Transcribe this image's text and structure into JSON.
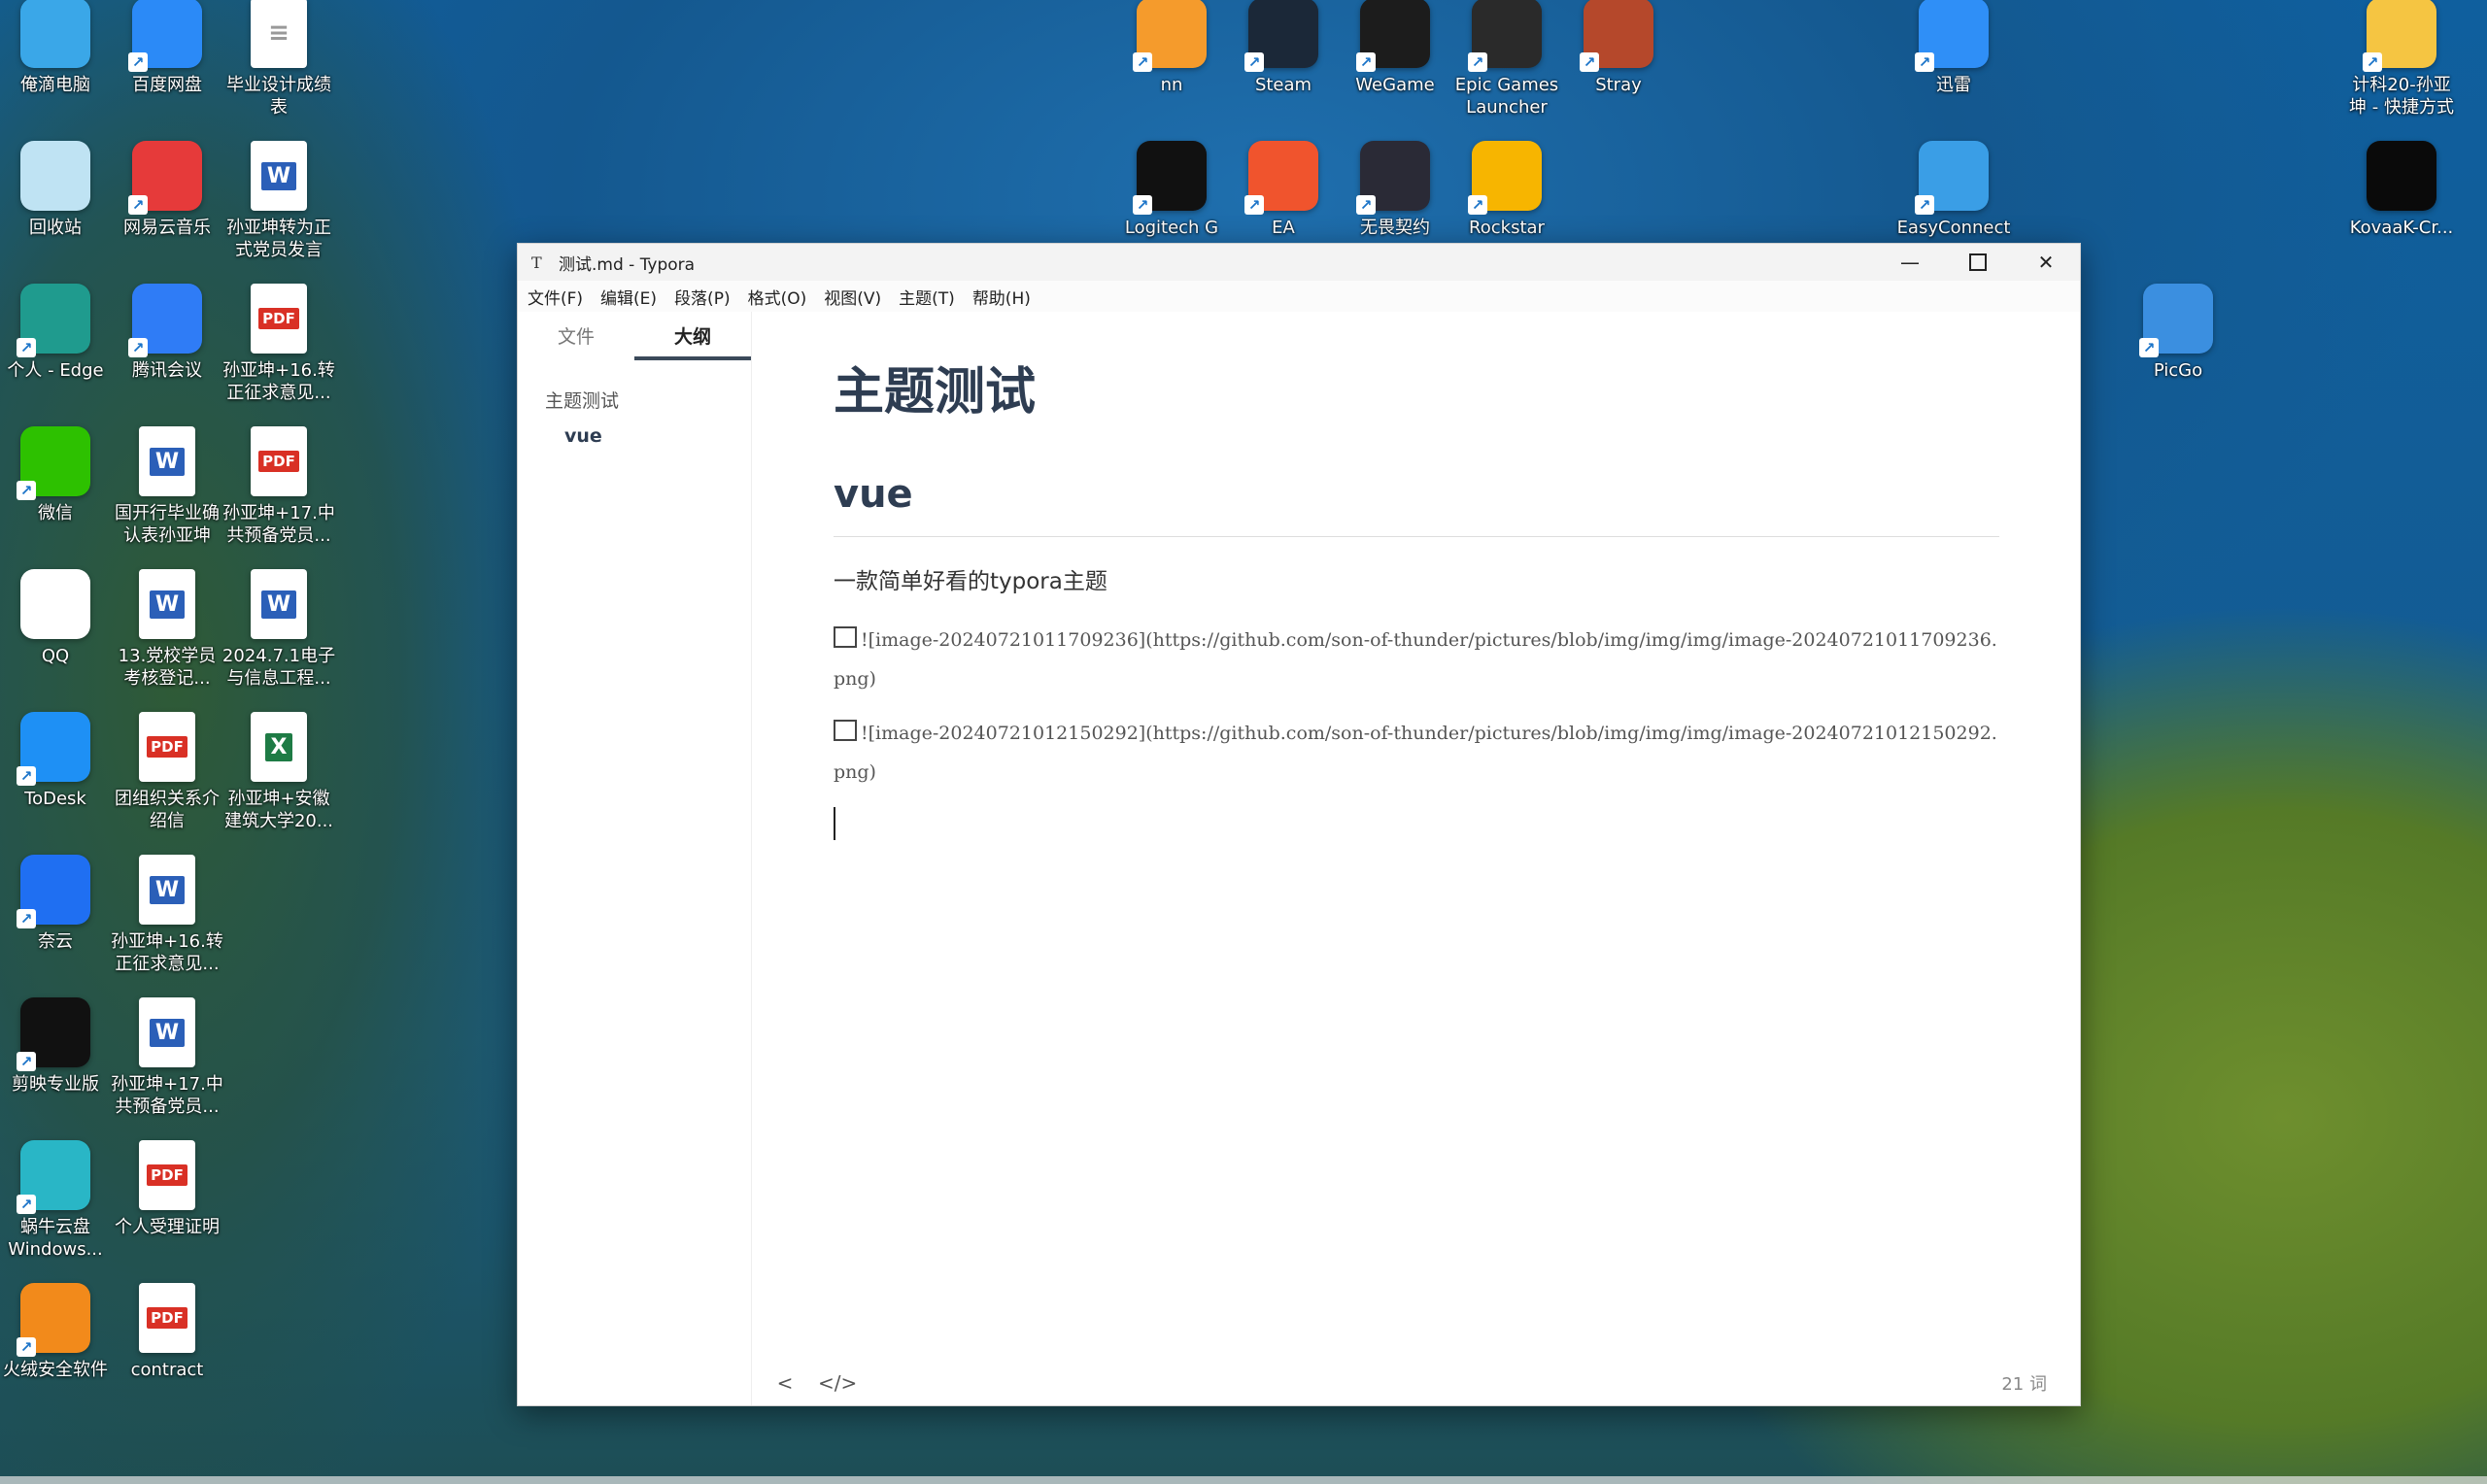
{
  "desktop": {
    "left_icons": [
      {
        "label": "俺滴电脑",
        "icon": "computer-icon",
        "color": "#3aa7e8",
        "x": 0,
        "y": 0,
        "shortcut": false
      },
      {
        "label": "百度网盘",
        "icon": "baidu-netdisk-icon",
        "color": "#2b8af7",
        "x": 1,
        "y": 0,
        "shortcut": true
      },
      {
        "label": "毕业设计成绩\n表",
        "icon": "document-icon",
        "color": "#ffffff",
        "x": 2,
        "y": 0,
        "shortcut": false
      },
      {
        "label": "回收站",
        "icon": "recycle-bin-icon",
        "color": "#bfe3f3",
        "x": 0,
        "y": 1,
        "shortcut": false
      },
      {
        "label": "网易云音乐",
        "icon": "netease-music-icon",
        "color": "#e63a3a",
        "x": 1,
        "y": 1,
        "shortcut": true
      },
      {
        "label": "孙亚坤转为正\n式党员发言",
        "icon": "word-doc-icon",
        "color": "#ffffff",
        "x": 2,
        "y": 1,
        "shortcut": false
      },
      {
        "label": "个人 - Edge",
        "icon": "edge-icon",
        "color": "#1f9b8e",
        "x": 0,
        "y": 2,
        "shortcut": true
      },
      {
        "label": "腾讯会议",
        "icon": "tencent-meeting-icon",
        "color": "#2f7cf6",
        "x": 1,
        "y": 2,
        "shortcut": true
      },
      {
        "label": "孙亚坤+16.转\n正征求意见...",
        "icon": "pdf-icon",
        "color": "#ffffff",
        "x": 2,
        "y": 2,
        "shortcut": false
      },
      {
        "label": "微信",
        "icon": "wechat-icon",
        "color": "#2dc100",
        "x": 0,
        "y": 3,
        "shortcut": true
      },
      {
        "label": "国开行毕业确\n认表孙亚坤",
        "icon": "word-doc-icon",
        "color": "#ffffff",
        "x": 1,
        "y": 3,
        "shortcut": false
      },
      {
        "label": "孙亚坤+17.中\n共预备党员...",
        "icon": "pdf-icon",
        "color": "#ffffff",
        "x": 2,
        "y": 3,
        "shortcut": false
      },
      {
        "label": "QQ",
        "icon": "qq-icon",
        "color": "#ffffff",
        "x": 0,
        "y": 4,
        "shortcut": false
      },
      {
        "label": "13.党校学员\n考核登记...",
        "icon": "word-doc-icon",
        "color": "#ffffff",
        "x": 1,
        "y": 4,
        "shortcut": false
      },
      {
        "label": "2024.7.1电子\n与信息工程...",
        "icon": "word-doc-icon",
        "color": "#ffffff",
        "x": 2,
        "y": 4,
        "shortcut": false
      },
      {
        "label": "ToDesk",
        "icon": "todesk-icon",
        "color": "#1e90f5",
        "x": 0,
        "y": 5,
        "shortcut": true
      },
      {
        "label": "团组织关系介\n绍信",
        "icon": "pdf-icon",
        "color": "#ffffff",
        "x": 1,
        "y": 5,
        "shortcut": false
      },
      {
        "label": "孙亚坤+安徽\n建筑大学20...",
        "icon": "excel-icon",
        "color": "#ffffff",
        "x": 2,
        "y": 5,
        "shortcut": false
      },
      {
        "label": "奈云",
        "icon": "naiyun-icon",
        "color": "#1f6ff2",
        "x": 0,
        "y": 6,
        "shortcut": true
      },
      {
        "label": "孙亚坤+16.转\n正征求意见...",
        "icon": "word-doc-icon",
        "color": "#ffffff",
        "x": 1,
        "y": 6,
        "shortcut": false
      },
      {
        "label": "剪映专业版",
        "icon": "capcut-icon",
        "color": "#111111",
        "x": 0,
        "y": 7,
        "shortcut": true
      },
      {
        "label": "孙亚坤+17.中\n共预备党员...",
        "icon": "word-doc-icon",
        "color": "#ffffff",
        "x": 1,
        "y": 7,
        "shortcut": false
      },
      {
        "label": "蜗牛云盘\nWindows...",
        "icon": "snail-cloud-icon",
        "color": "#29b6c6",
        "x": 0,
        "y": 8,
        "shortcut": true
      },
      {
        "label": "个人受理证明",
        "icon": "pdf-icon",
        "color": "#ffffff",
        "x": 1,
        "y": 8,
        "shortcut": false
      },
      {
        "label": "火绒安全软件",
        "icon": "huorong-icon",
        "color": "#f28a1b",
        "x": 0,
        "y": 9,
        "shortcut": true
      },
      {
        "label": "contract",
        "icon": "pdf-icon",
        "color": "#ffffff",
        "x": 1,
        "y": 9,
        "shortcut": false
      }
    ],
    "top_icons": [
      {
        "label": "nn",
        "icon": "nn-accelerator-icon",
        "color": "#f59b2c",
        "col": 0,
        "row": 0
      },
      {
        "label": "Steam",
        "icon": "steam-icon",
        "color": "#1b2838",
        "col": 1,
        "row": 0
      },
      {
        "label": "WeGame",
        "icon": "wegame-icon",
        "color": "#1c1c1c",
        "col": 2,
        "row": 0
      },
      {
        "label": "Epic Games\nLauncher",
        "icon": "epic-games-icon",
        "color": "#2a2a2a",
        "col": 3,
        "row": 0
      },
      {
        "label": "Stray",
        "icon": "stray-icon",
        "color": "#b5482b",
        "col": 4,
        "row": 0
      },
      {
        "label": "Logitech G",
        "icon": "logitech-g-icon",
        "color": "#111111",
        "col": 0,
        "row": 1
      },
      {
        "label": "EA",
        "icon": "ea-icon",
        "color": "#f0542d",
        "col": 1,
        "row": 1
      },
      {
        "label": "无畏契约",
        "icon": "valorant-icon",
        "color": "#2a2a36",
        "col": 2,
        "row": 1
      },
      {
        "label": "Rockstar",
        "icon": "rockstar-icon",
        "color": "#f7b500",
        "col": 3,
        "row": 1
      }
    ],
    "right_icons": [
      {
        "label": "迅雷",
        "icon": "xunlei-icon",
        "color": "#2f8ff7"
      },
      {
        "label": "EasyConnect",
        "icon": "easyconnect-icon",
        "color": "#3a9ee6"
      },
      {
        "label": "计科20-孙亚\n坤 - 快捷方式",
        "icon": "folder-icon",
        "color": "#f5c542"
      },
      {
        "label": "KovaaK-Cr...",
        "icon": "kovaak-icon",
        "color": "#0a0a0a"
      },
      {
        "label": "PicGo",
        "icon": "picgo-icon",
        "color": "#3b8fe0"
      }
    ]
  },
  "window": {
    "title": "测试.md - Typora",
    "app_icon": "T",
    "menu": [
      "文件(F)",
      "编辑(E)",
      "段落(P)",
      "格式(O)",
      "视图(V)",
      "主题(T)",
      "帮助(H)"
    ],
    "sidebar": {
      "tabs": [
        "文件",
        "大纲"
      ],
      "active_tab": "大纲",
      "outline": [
        {
          "level": 1,
          "text": "主题测试"
        },
        {
          "level": 2,
          "text": "vue"
        }
      ]
    },
    "doc": {
      "h1": "主题测试",
      "h2": "vue",
      "paragraph": "一款简单好看的typora主题",
      "images": [
        "![image-20240721011709236](https://github.com/son-of-thunder/pictures/blob/img/img/img/image-20240721011709236.png)",
        "![image-20240721012150292](https://github.com/son-of-thunder/pictures/blob/img/img/img/image-20240721012150292.png)"
      ]
    },
    "footer": {
      "back": "<",
      "source": "</>",
      "word_count": "21 词"
    }
  }
}
